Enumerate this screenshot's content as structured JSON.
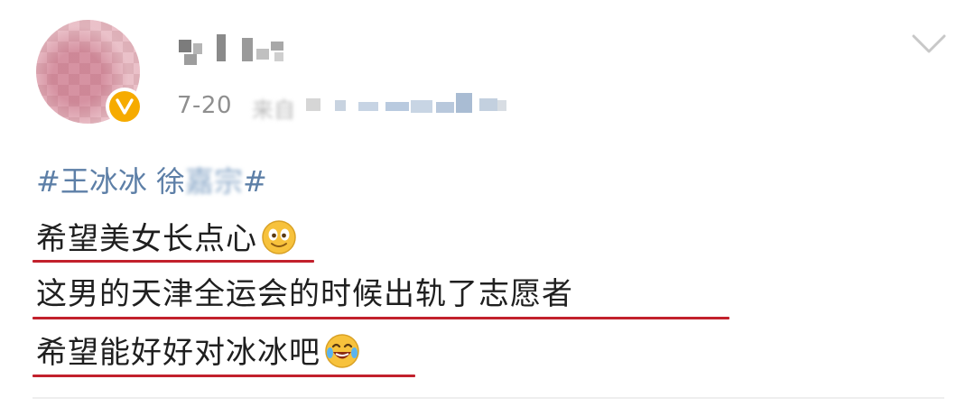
{
  "post": {
    "author": {
      "name": "",
      "verified": true,
      "verify_color": "#f6ab00"
    },
    "date": "7-20",
    "source": "来自",
    "hashtag": {
      "prefix": "#王冰冰 徐",
      "blurred": "嘉宗",
      "suffix": "#"
    },
    "lines": [
      {
        "text": "希望美女长点心",
        "emoji": "smile-emoji"
      },
      {
        "text": "这男的天津全运会的时候出轨了志愿者"
      },
      {
        "text": "希望能好好对冰冰吧",
        "emoji": "laugh-cry-emoji"
      }
    ],
    "underline_color": "#c2212c",
    "hashtag_color": "#5d7fa7",
    "collapse_icon": "chevron-down-icon"
  }
}
